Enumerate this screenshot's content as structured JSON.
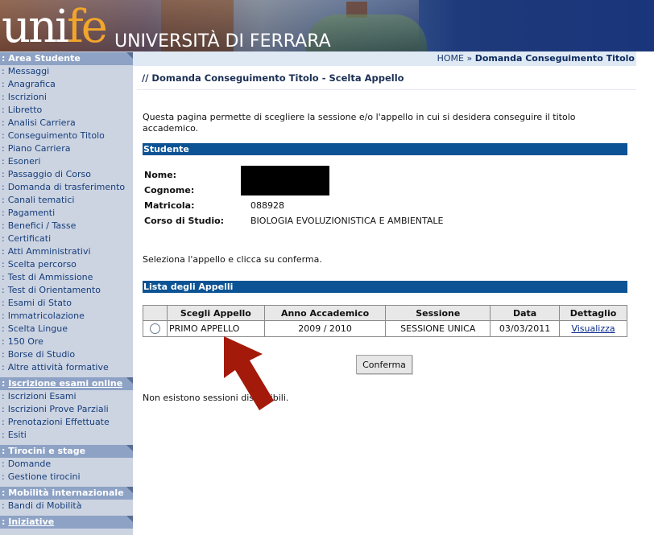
{
  "header": {
    "logo_uni": "uni",
    "logo_fe": "fe",
    "university": "UNIVERSITÀ DI FERRARA"
  },
  "sidebar": {
    "sections": [
      {
        "title": "Area Studente",
        "underlined": false,
        "items": [
          "Messaggi",
          "Anagrafica",
          "Iscrizioni",
          "Libretto",
          "Analisi Carriera",
          "Conseguimento Titolo",
          "Piano Carriera",
          "Esoneri",
          "Passaggio di Corso",
          "Domanda di trasferimento",
          "Canali tematici",
          "Pagamenti",
          "Benefici / Tasse",
          "Certificati",
          "Atti Amministrativi",
          "Scelta percorso",
          "Test di Ammissione",
          "Test di Orientamento",
          "Esami di Stato",
          "Immatricolazione",
          "Scelta Lingue",
          "150 Ore",
          "Borse di Studio",
          "Altre attività formative"
        ]
      },
      {
        "title": "Iscrizione esami online",
        "underlined": true,
        "items": [
          "Iscrizioni Esami",
          "Iscrizioni Prove Parziali",
          "Prenotazioni Effettuate",
          "Esiti"
        ]
      },
      {
        "title": "Tirocini e stage",
        "underlined": false,
        "items": [
          "Domande",
          "Gestione tirocini"
        ]
      },
      {
        "title": "Mobilità internazionale",
        "underlined": false,
        "items": [
          "Bandi di Mobilità"
        ]
      },
      {
        "title": "Iniziative",
        "underlined": true,
        "items": []
      }
    ]
  },
  "breadcrumb": {
    "home": "HOME",
    "separator": "»",
    "current": "Domanda Conseguimento Titolo"
  },
  "page": {
    "title": "// Domanda Conseguimento Titolo - Scelta Appello",
    "intro": "Questa pagina permette di scegliere la sessione e/o l'appello in cui si desidera conseguire il titolo accademico.",
    "student_section": "Studente",
    "labels": {
      "nome": "Nome:",
      "cognome": "Cognome:",
      "matricola": "Matricola:",
      "corso": "Corso di Studio:"
    },
    "values": {
      "matricola": "088928",
      "corso": "BIOLOGIA EVOLUZIONISTICA E AMBIENTALE"
    },
    "instruction": "Seleziona l'appello e clicca su conferma.",
    "list_section": "Lista degli Appelli",
    "table": {
      "headers": [
        "",
        "Scegli Appello",
        "Anno Accademico",
        "Sessione",
        "Data",
        "Dettaglio"
      ],
      "rows": [
        {
          "appello": "PRIMO APPELLO",
          "anno": "2009 / 2010",
          "sessione": "SESSIONE UNICA",
          "data": "03/03/2011",
          "dettaglio": "Visualizza"
        }
      ]
    },
    "confirm_button": "Conferma",
    "no_sessions": "Non esistono sessioni disponibili."
  },
  "colors": {
    "sidebar_bg": "#ccd4e2",
    "sidebar_header": "#8da2c4",
    "section_bar": "#0b5394",
    "arrow": "#a41a0a",
    "logo_accent": "#f2a52b"
  }
}
